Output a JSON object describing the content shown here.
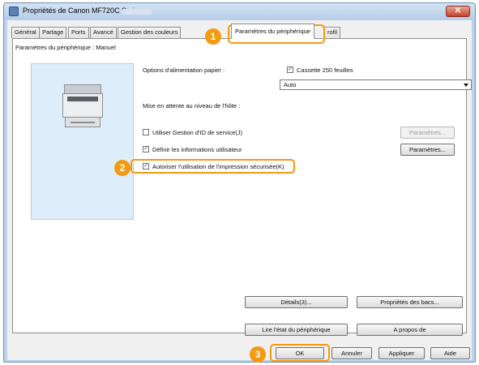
{
  "window": {
    "title": "Propriétés de Canon MF720C Series",
    "close_glyph": "✕"
  },
  "tabs": [
    {
      "label": "Général"
    },
    {
      "label": "Partage"
    },
    {
      "label": "Ports"
    },
    {
      "label": "Avancé"
    },
    {
      "label": "Gestion des couleurs"
    },
    {
      "label": "Paramètres du périphérique"
    },
    {
      "label": "rofil"
    }
  ],
  "panel": {
    "title": "Paramètres du périphérique : Manuel",
    "paper_feed_label": "Options d'alimentation papier :",
    "cassette_label": "Cassette 250 feuilles",
    "host_spooling_label": "Mise en attente au niveau de l'hôte :",
    "host_spooling_value": "Auto",
    "dept_id_label": "Utiliser Gestion d'ID de service(J)",
    "user_info_label": "Définir les informations utilisateur",
    "secure_print_label": "Autoriser l'utilisation de l'impression sécurisée(K)",
    "settings_button_1": "Paramètres...",
    "settings_button_2": "Paramètres...",
    "details_button": "Détails(3)...",
    "tray_props_button": "Propriétés des bacs...",
    "read_status_button": "Lire l'état du périphérique",
    "about_button": "A propos de"
  },
  "footer": {
    "ok": "OK",
    "cancel": "Annuler",
    "apply": "Appliquer",
    "help": "Aide"
  },
  "callouts": [
    "1",
    "2",
    "3"
  ],
  "checks": {
    "checked_glyph": "✓"
  },
  "colors": {
    "accent": "#f39a10",
    "preview_bg": "#ddeefa",
    "titlebar": "#b9d1ea"
  }
}
